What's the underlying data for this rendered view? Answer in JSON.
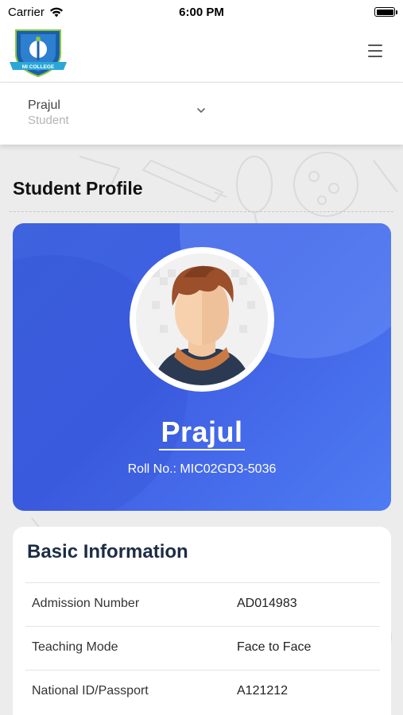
{
  "status_bar": {
    "carrier": "Carrier",
    "time": "6:00 PM"
  },
  "header": {
    "logo_text": "MI COLLEGE",
    "menu_icon": "hamburger-menu-icon"
  },
  "user_selector": {
    "name": "Prajul",
    "role": "Student",
    "icon": "chevron-down-icon"
  },
  "page": {
    "title": "Student Profile"
  },
  "profile": {
    "name": "Prajul",
    "roll_number": "Roll No.: MIC02GD3-5036"
  },
  "basic_info": {
    "title": "Basic Information",
    "rows": [
      {
        "label": "Admission Number",
        "value": "AD014983"
      },
      {
        "label": "Teaching Mode",
        "value": "Face to Face"
      },
      {
        "label": "National ID/Passport",
        "value": "A121212"
      }
    ]
  },
  "colors": {
    "card_gradient_start": "#3e63de",
    "card_gradient_end": "#4e7bf3",
    "info_title": "#1c2d45",
    "background": "#ececec"
  }
}
